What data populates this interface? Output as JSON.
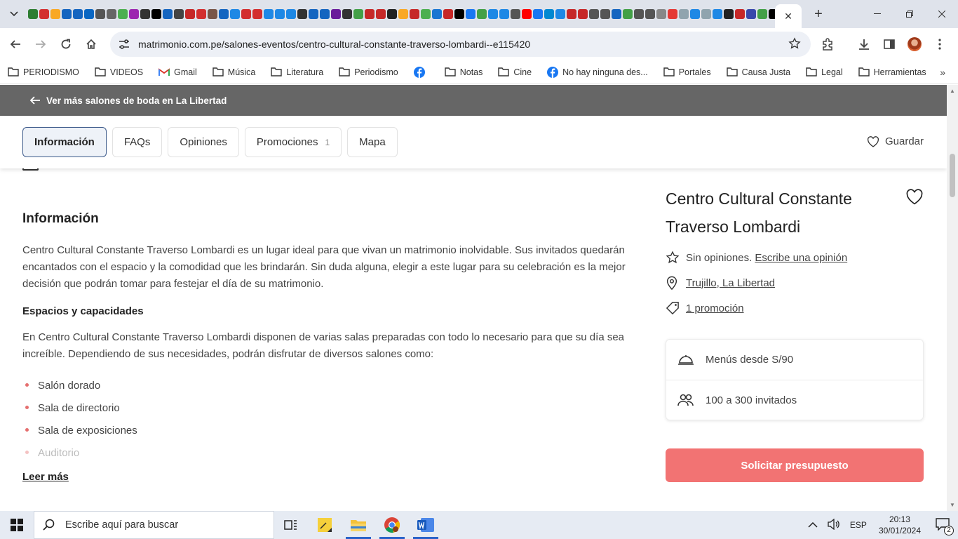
{
  "browser": {
    "active_tab_close": "✕",
    "new_tab": "+",
    "url": "matrimonio.com.pe/salones-eventos/centro-cultural-constante-traverso-lombardi--e115420",
    "favicon_colors": [
      "#2e7d32",
      "#d32f2f",
      "#f9a825",
      "#1565c0",
      "#1565c0",
      "#0a66c2",
      "#555",
      "#666",
      "#4caf50",
      "#9c27b0",
      "#333",
      "#000",
      "#1565c0",
      "#444",
      "#c62828",
      "#d32f2f",
      "#795548",
      "#1565c0",
      "#1e88e5",
      "#d32f2f",
      "#d32f2f",
      "#1e88e5",
      "#1e88e5",
      "#1e88e5",
      "#333",
      "#1565c0",
      "#1565c0",
      "#6a1b9a",
      "#333",
      "#43a047",
      "#c62828",
      "#c62828",
      "#222",
      "#f9a825",
      "#c62828",
      "#4caf50",
      "#1976d2",
      "#c62828",
      "#000",
      "#1877f2",
      "#43a047",
      "#1e88e5",
      "#1e88e5",
      "#555",
      "#ff0000",
      "#1877f2",
      "#0288d1",
      "#1e88e5",
      "#c62828",
      "#c62828",
      "#555",
      "#555",
      "#1565c0",
      "#43a047",
      "#555",
      "#555",
      "#888",
      "#e53935",
      "#90a4ae",
      "#1e88e5",
      "#90a4ae",
      "#1e88e5",
      "#222",
      "#c62828",
      "#3949ab",
      "#43a047",
      "#000",
      "#1565c0",
      "#1565c0",
      "#c62828",
      "#555"
    ]
  },
  "bookmarks": [
    {
      "label": "PERIODISMO",
      "icon": "folder-icon"
    },
    {
      "label": "VIDEOS",
      "icon": "folder-icon"
    },
    {
      "label": "Gmail",
      "icon": "gmail-icon"
    },
    {
      "label": "Música",
      "icon": "folder-icon"
    },
    {
      "label": "Literatura",
      "icon": "folder-icon"
    },
    {
      "label": "Periodismo",
      "icon": "folder-icon"
    },
    {
      "label": "",
      "icon": "facebook-icon"
    },
    {
      "label": "Notas",
      "icon": "folder-icon"
    },
    {
      "label": "Cine",
      "icon": "folder-icon"
    },
    {
      "label": "No hay ninguna des...",
      "icon": "facebook-icon"
    },
    {
      "label": "Portales",
      "icon": "folder-icon"
    },
    {
      "label": "Causa Justa",
      "icon": "folder-icon"
    },
    {
      "label": "Legal",
      "icon": "folder-icon"
    },
    {
      "label": "Herramientas",
      "icon": "folder-icon"
    }
  ],
  "page": {
    "back_link": "Ver más salones de boda en La Libertad",
    "tabs": [
      {
        "label": "Información",
        "count": ""
      },
      {
        "label": "FAQs",
        "count": ""
      },
      {
        "label": "Opiniones",
        "count": ""
      },
      {
        "label": "Promociones",
        "count": "1"
      },
      {
        "label": "Mapa",
        "count": ""
      }
    ],
    "save_label": "Guardar",
    "section_title": "Información",
    "intro": "Centro Cultural Constante Traverso Lombardi es un lugar ideal para que vivan un matrimonio inolvidable. Sus invitados quedarán encantados con el espacio y la comodidad que les brindarán. Sin duda alguna, elegir a este lugar para su celebración es la mejor decisión que podrán tomar para festejar el día de su matrimonio.",
    "subheading": "Espacios y capacidades",
    "spaces_text": "En Centro Cultural Constante Traverso Lombardi disponen de varias salas preparadas con todo lo necesario para que su día sea increíble. Dependiendo de sus necesidades, podrán disfrutar de diversos salones como:",
    "spaces": [
      "Salón dorado",
      "Sala de directorio",
      "Sala de exposiciones",
      "Auditorio"
    ],
    "read_more": "Leer más"
  },
  "venue": {
    "name": "Centro Cultural Constante Traverso Lombardi",
    "no_reviews": "Sin opiniones.",
    "write_review": "Escribe una opinión",
    "location": "Trujillo, La Libertad",
    "promotion": "1 promoción",
    "menus": "Menús desde S/90",
    "guests": "100 a 300 invitados",
    "cta": "Solicitar presupuesto"
  },
  "taskbar": {
    "search_placeholder": "Escribe aquí para buscar",
    "lang": "ESP",
    "time": "20:13",
    "date": "30/01/2024",
    "notifications": "2"
  },
  "colors": {
    "accent": "#f27373",
    "bullet": "#e56f6f",
    "tab_active_border": "#3c5a8a"
  }
}
